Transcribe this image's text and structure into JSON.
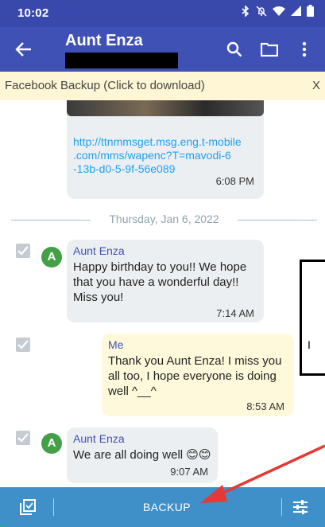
{
  "status_bar": {
    "time": "10:02",
    "icons": [
      "bluetooth-icon",
      "mute-icon",
      "wifi-icon",
      "signal-icon",
      "battery-icon"
    ]
  },
  "app_bar": {
    "title": "Aunt Enza",
    "back_icon": "arrow-left-icon",
    "actions": [
      "search-icon",
      "folder-icon",
      "more-vert-icon"
    ]
  },
  "banner": {
    "text": "Facebook Backup (Click to download)",
    "close": "X"
  },
  "conversation": {
    "first_message": {
      "link": "http://ttnmmsget.msg.eng.t-mobile.com/mms/wapenc?T=mavodi-6-13b-d0-5-9f-56e089",
      "link_lines": [
        "http://ttnmmsget.msg.eng.t-mobile",
        ".com/mms/wapenc?T=mavodi-6",
        "-13b-d0-5-9f-56e089"
      ],
      "time": "6:08 PM"
    },
    "date_divider": "Thursday, Jan 6, 2022",
    "messages": [
      {
        "sender": "Aunt Enza",
        "avatar": "A",
        "lines": [
          "Happy birthday to you!! We hope",
          "that you have a wonderful day!!",
          "Miss you!"
        ],
        "time": "7:14 AM",
        "direction": "incoming"
      },
      {
        "sender": "Me",
        "lines": [
          "Thank you Aunt Enza! I miss you",
          "all too, I hope everyone is doing",
          "well ^__^"
        ],
        "time": "8:53 AM",
        "direction": "outgoing"
      },
      {
        "sender": "Aunt Enza",
        "avatar": "A",
        "lines": [
          "We are all doing well 😊😊"
        ],
        "time": "9:07 AM",
        "direction": "incoming"
      }
    ]
  },
  "bottom_bar": {
    "backup_label": "BACKUP",
    "left_icon": "select-all-icon",
    "right_icon": "settings-sliders-icon"
  },
  "colors": {
    "status_bar": "#3949ab",
    "app_bar": "#3f51b5",
    "banner": "#fff6d5",
    "incoming_bubble": "#eceff1",
    "outgoing_bubble": "#fff9db",
    "link": "#1da1f2",
    "avatar": "#43a047",
    "bottom_bar": "#3f8fc8",
    "annotation_arrow": "#e53935"
  }
}
